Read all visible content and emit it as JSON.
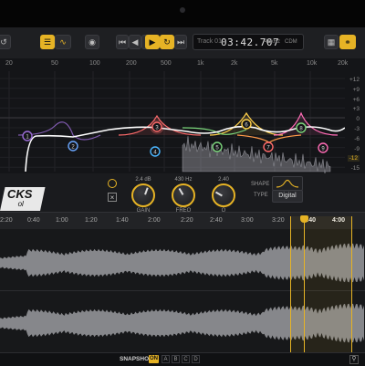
{
  "toolbar": {
    "track_label": "Track 01",
    "time": "03:42.707",
    "sample_rate": "48kHz",
    "format": "CDM"
  },
  "eq": {
    "freq_labels": [
      "20",
      "50",
      "100",
      "200",
      "500",
      "1k",
      "2k",
      "5k",
      "10k",
      "20k"
    ],
    "db_labels": [
      "+12",
      "+9",
      "+6",
      "+3",
      "0",
      "-3",
      "-6",
      "-9",
      "-12",
      "-15",
      "-18"
    ],
    "db_highlight": "-12",
    "bands": [
      "1",
      "2",
      "3",
      "4",
      "5",
      "6",
      "7",
      "8",
      "9"
    ],
    "gain_value": "2.4 dB",
    "gain_label": "GAIN",
    "freq_value": "430 Hz",
    "freq_label": "FREQ",
    "q_value": "2.40",
    "q_label": "Q",
    "shape_label": "SHAPE",
    "type_label": "TYPE",
    "type_value": "Digital",
    "band_colors": {
      "1": "#9b6cd6",
      "2": "#6aa6ff",
      "3": "#ff6b6b",
      "4": "#4bb6ff",
      "5": "#ff9a4a",
      "6": "#7bd67b",
      "7": "#ffd04b",
      "8": "#ff6bb5",
      "9": "#3ecfb0"
    }
  },
  "logo": {
    "main": "CKS",
    "sub": "ol"
  },
  "timeline": {
    "ticks": [
      "2:20",
      "0:40",
      "1:00",
      "1:20",
      "1:40",
      "2:00",
      "2:20",
      "2:40",
      "3:00",
      "3:20",
      "3:40",
      "4:00"
    ],
    "bold_ticks": [
      "3:40",
      "4:00"
    ]
  },
  "bottom": {
    "snapshot_label": "SNAPSHOT",
    "snapshot_on": "ON",
    "slots": [
      "A",
      "B",
      "C",
      "D"
    ]
  },
  "colors": {
    "accent": "#e6b325"
  }
}
